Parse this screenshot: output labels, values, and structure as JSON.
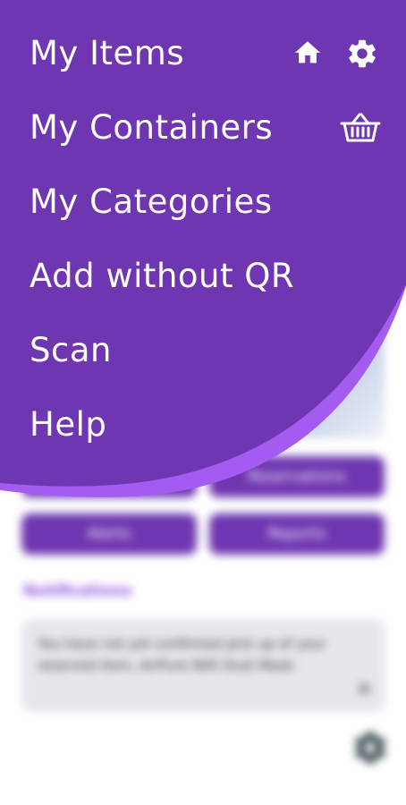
{
  "menu": {
    "items": [
      {
        "label": "My Items"
      },
      {
        "label": "My Containers"
      },
      {
        "label": "My Categories"
      },
      {
        "label": "Add without QR"
      },
      {
        "label": "Scan"
      },
      {
        "label": "Help"
      }
    ],
    "icons": {
      "home": "home-icon",
      "settings": "gear-icon",
      "basket": "basket-icon"
    }
  },
  "background": {
    "buttons": [
      {
        "label": ""
      },
      {
        "label": "Reservations"
      },
      {
        "label": "Alerts"
      },
      {
        "label": "Reports"
      }
    ],
    "notifications": {
      "title": "Notifications",
      "message": "You have not yet confirmed pick up of your reserved item, AirPure N95 Dust Mask.",
      "close": "×"
    }
  },
  "colors": {
    "menu_purple": "#6e36b0",
    "accent_purple": "#a45cf0",
    "white": "#ffffff"
  }
}
